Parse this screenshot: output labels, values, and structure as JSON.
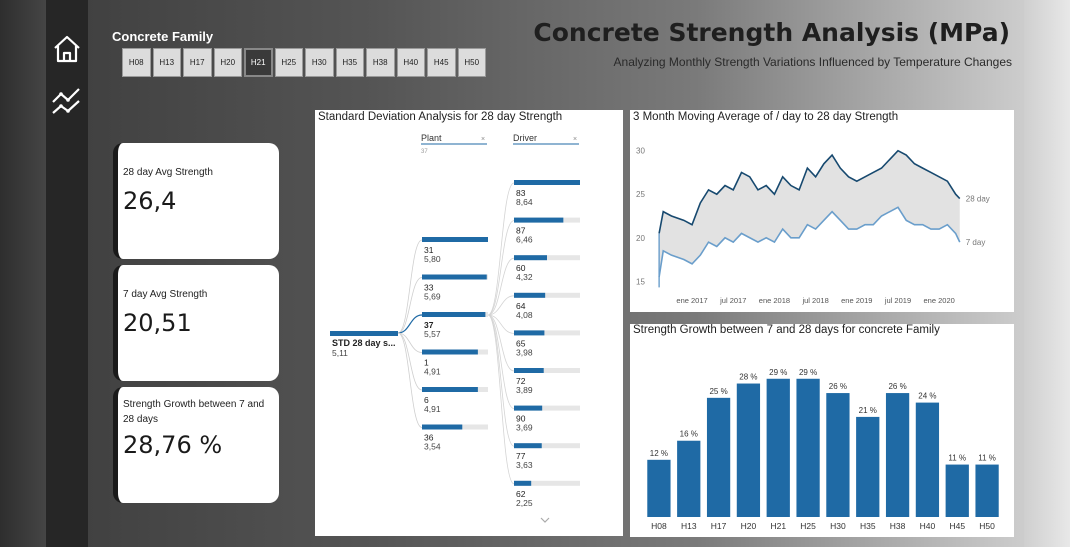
{
  "header": {
    "title": "Concrete Strength Analysis (MPa)",
    "subtitle": "Analyzing Monthly Strength Variations Influenced by Temperature Changes"
  },
  "nav": {
    "icons": [
      "home-icon",
      "trend-line-icon"
    ]
  },
  "slicer": {
    "title": "Concrete Family",
    "options": [
      "H08",
      "H13",
      "H17",
      "H20",
      "H21",
      "H25",
      "H30",
      "H35",
      "H38",
      "H40",
      "H45",
      "H50"
    ],
    "selected": "H21"
  },
  "cards": [
    {
      "label": "28 day Avg Strength",
      "value": "26,4"
    },
    {
      "label": "7 day Avg Strength",
      "value": "20,51"
    },
    {
      "label": "Strength Growth between 7 and 28 days",
      "value": "28,76 %"
    }
  ],
  "colors": {
    "bar": "#1f6aa5",
    "line_dark": "#17496f",
    "line_light": "#6a9ecb",
    "bar_bg": "#e6e6e6"
  },
  "chart_data": [
    {
      "type": "decomposition-tree",
      "title": "Standard Deviation Analysis for 28 day Strength",
      "root": {
        "label": "STD 28 day s...",
        "value": "5,11"
      },
      "levels": [
        {
          "name": "Plant",
          "sub": "37"
        },
        {
          "name": "Driver",
          "sub": ""
        }
      ],
      "plant": [
        {
          "id": "31",
          "value": 5.8,
          "label": "5,80"
        },
        {
          "id": "33",
          "value": 5.69,
          "label": "5,69"
        },
        {
          "id": "37",
          "value": 5.57,
          "label": "5,57",
          "selected": true
        },
        {
          "id": "1",
          "value": 4.91,
          "label": "4,91"
        },
        {
          "id": "6",
          "value": 4.91,
          "label": "4,91"
        },
        {
          "id": "36",
          "value": 3.54,
          "label": "3,54"
        }
      ],
      "driver": [
        {
          "id": "83",
          "value": 8.64,
          "label": "8,64"
        },
        {
          "id": "87",
          "value": 6.46,
          "label": "6,46"
        },
        {
          "id": "60",
          "value": 4.32,
          "label": "4,32"
        },
        {
          "id": "64",
          "value": 4.08,
          "label": "4,08"
        },
        {
          "id": "65",
          "value": 3.98,
          "label": "3,98"
        },
        {
          "id": "72",
          "value": 3.89,
          "label": "3,89"
        },
        {
          "id": "90",
          "value": 3.69,
          "label": "3,69"
        },
        {
          "id": "77",
          "value": 3.63,
          "label": "3,63"
        },
        {
          "id": "62",
          "value": 2.25,
          "label": "2,25"
        }
      ],
      "scale_max": 8.64
    },
    {
      "type": "line",
      "title": "3 Month Moving Average of / day to 28 day Strength",
      "x_ticks": [
        "ene 2017",
        "jul 2017",
        "ene 2018",
        "jul 2018",
        "ene 2019",
        "jul 2019",
        "ene 2020"
      ],
      "y_ticks": [
        15,
        20,
        25,
        30
      ],
      "ylim": [
        14,
        31
      ],
      "xlim": [
        2016.55,
        2020.35
      ],
      "series": [
        {
          "name": "28 day",
          "x": [
            2016.6,
            2016.65,
            2016.75,
            2016.9,
            2017.0,
            2017.1,
            2017.2,
            2017.3,
            2017.4,
            2017.5,
            2017.6,
            2017.7,
            2017.8,
            2017.9,
            2018.0,
            2018.1,
            2018.2,
            2018.3,
            2018.4,
            2018.5,
            2018.6,
            2018.7,
            2018.8,
            2018.9,
            2019.0,
            2019.1,
            2019.2,
            2019.3,
            2019.4,
            2019.5,
            2019.6,
            2019.7,
            2019.8,
            2019.9,
            2020.0,
            2020.1,
            2020.2,
            2020.25
          ],
          "values": [
            20.5,
            23.0,
            22.5,
            22.0,
            21.5,
            24.0,
            25.5,
            25.0,
            26.0,
            25.5,
            27.5,
            27.0,
            25.5,
            26.0,
            25.0,
            27.0,
            26.0,
            25.5,
            28.0,
            27.0,
            28.5,
            29.5,
            28.0,
            27.0,
            26.5,
            27.0,
            27.5,
            28.0,
            29.0,
            30.0,
            29.5,
            28.5,
            28.0,
            27.5,
            27.0,
            26.5,
            25.0,
            24.5
          ]
        },
        {
          "name": "7 day",
          "x": [
            2016.6,
            2016.65,
            2016.75,
            2016.9,
            2017.0,
            2017.1,
            2017.2,
            2017.3,
            2017.4,
            2017.5,
            2017.6,
            2017.7,
            2017.8,
            2017.9,
            2018.0,
            2018.1,
            2018.2,
            2018.3,
            2018.4,
            2018.5,
            2018.6,
            2018.7,
            2018.8,
            2018.9,
            2019.0,
            2019.1,
            2019.2,
            2019.3,
            2019.4,
            2019.5,
            2019.6,
            2019.7,
            2019.8,
            2019.9,
            2020.0,
            2020.1,
            2020.2,
            2020.25
          ],
          "values": [
            15.5,
            18.5,
            18.0,
            17.5,
            17.0,
            18.0,
            19.5,
            19.0,
            20.0,
            19.5,
            20.5,
            20.0,
            19.5,
            20.0,
            19.5,
            21.0,
            20.0,
            20.0,
            21.5,
            21.0,
            22.0,
            23.0,
            22.0,
            21.0,
            21.0,
            21.5,
            21.5,
            22.5,
            23.0,
            23.5,
            22.0,
            21.5,
            21.5,
            21.0,
            21.0,
            21.5,
            20.5,
            19.5
          ]
        }
      ]
    },
    {
      "type": "bar",
      "title": "Strength Growth between 7 and 28 days for concrete Family",
      "categories": [
        "H08",
        "H13",
        "H17",
        "H20",
        "H21",
        "H25",
        "H30",
        "H35",
        "H38",
        "H40",
        "H45",
        "H50"
      ],
      "values": [
        12,
        16,
        25,
        28,
        29,
        29,
        26,
        21,
        26,
        24,
        11,
        11
      ],
      "labels": [
        "12 %",
        "16 %",
        "25 %",
        "28 %",
        "29 %",
        "29 %",
        "26 %",
        "21 %",
        "26 %",
        "24 %",
        "11 %",
        "11 %"
      ],
      "ylim": [
        0,
        30
      ]
    }
  ]
}
